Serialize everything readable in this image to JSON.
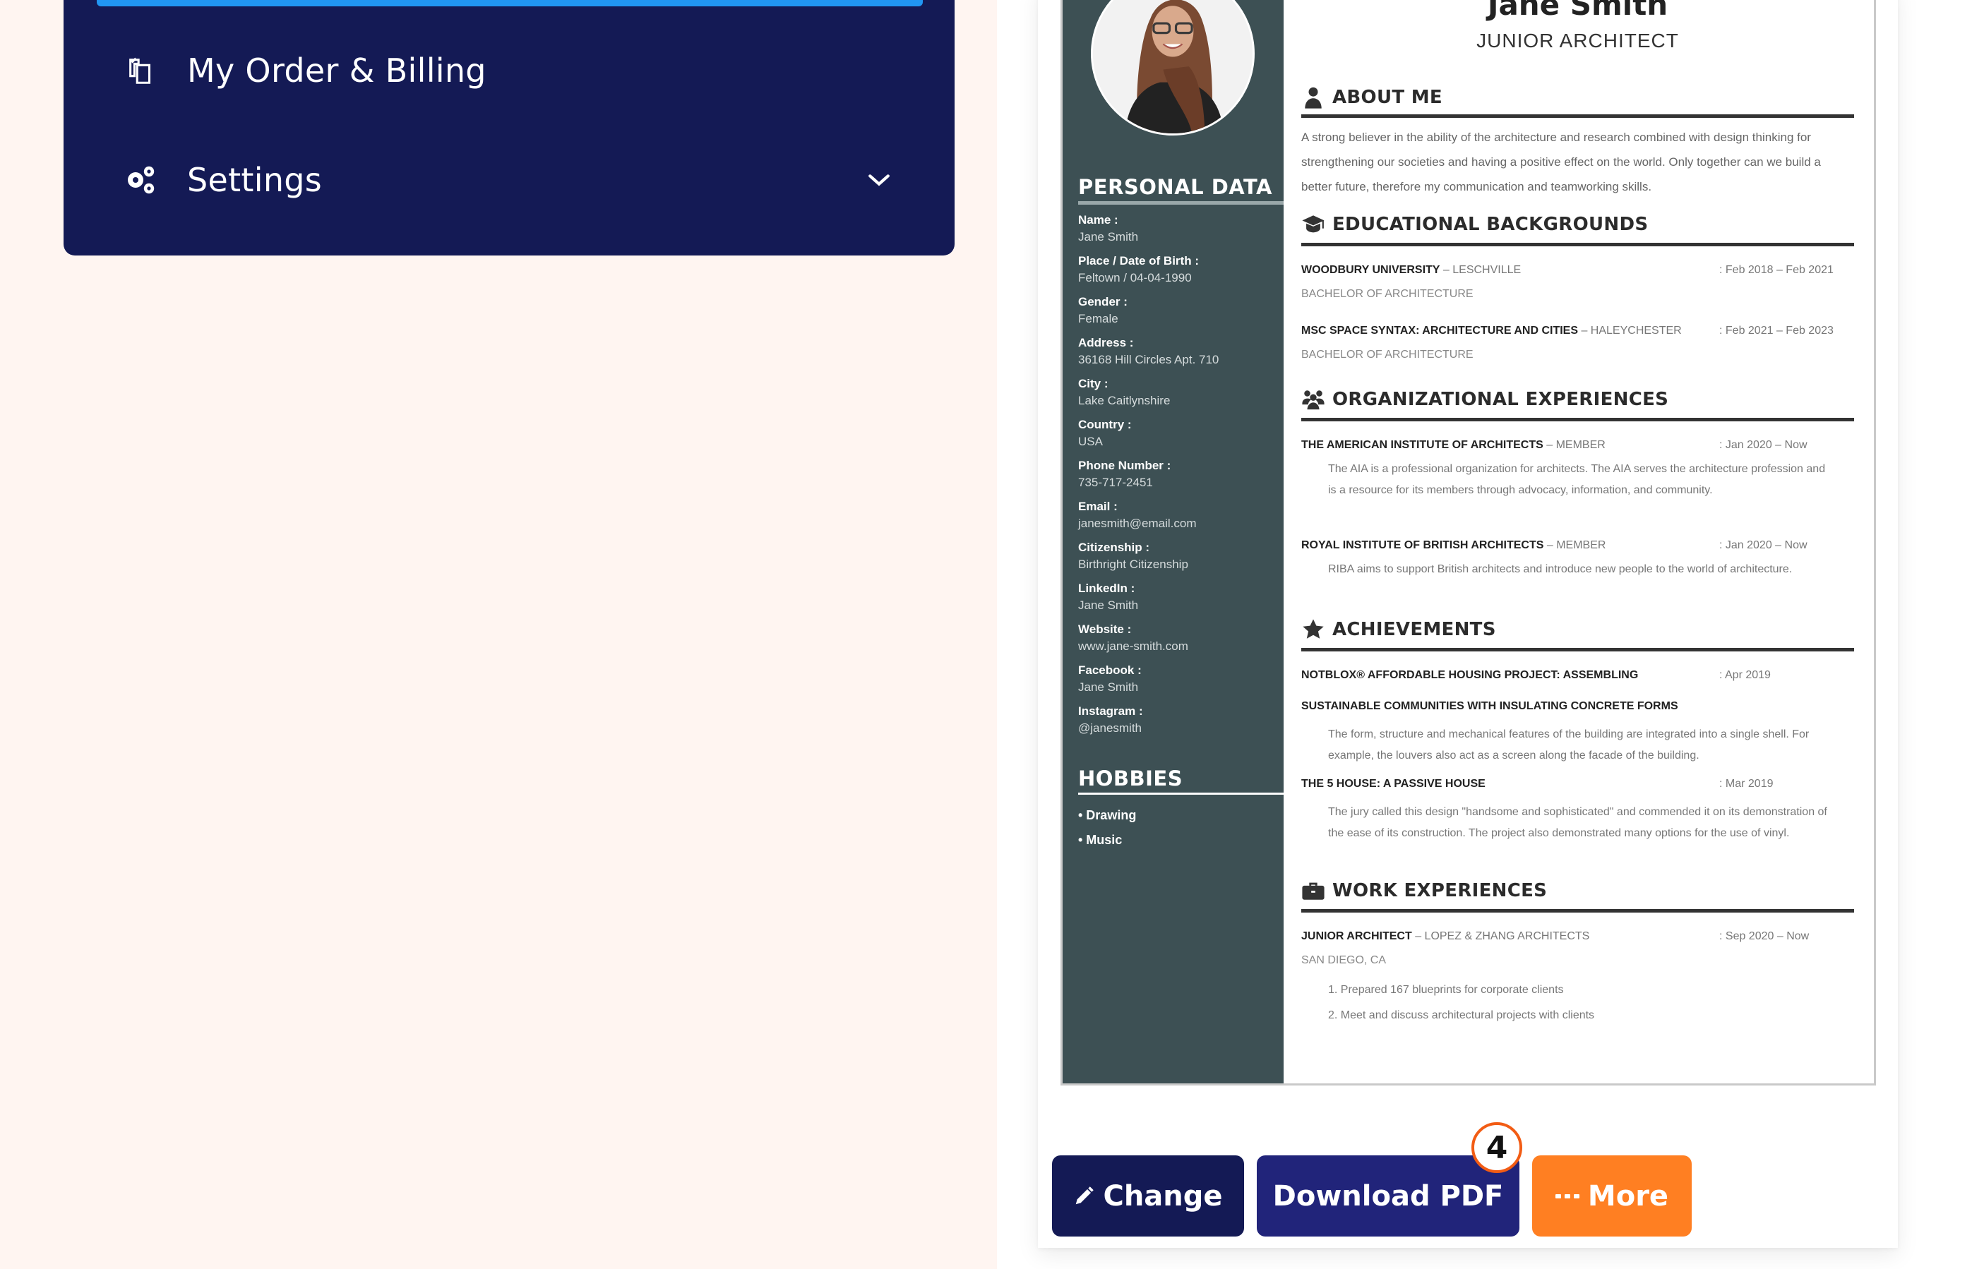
{
  "sidebar": {
    "items": [
      {
        "label": "My Order & Billing",
        "icon": "billing-icon"
      },
      {
        "label": "Settings",
        "icon": "gears-icon",
        "expandable": true
      }
    ]
  },
  "resume": {
    "name": "Jane Smith",
    "role": "JUNIOR ARCHITECT",
    "personal_data_title": "PERSONAL DATA",
    "personal_data": [
      {
        "key": "Name :",
        "value": "Jane Smith"
      },
      {
        "key": "Place / Date of Birth :",
        "value": "Feltown / 04-04-1990"
      },
      {
        "key": "Gender :",
        "value": "Female"
      },
      {
        "key": "Address :",
        "value": "36168 Hill Circles Apt. 710"
      },
      {
        "key": "City :",
        "value": "Lake Caitlynshire"
      },
      {
        "key": "Country :",
        "value": "USA"
      },
      {
        "key": "Phone Number :",
        "value": "735-717-2451"
      },
      {
        "key": "Email :",
        "value": "janesmith@email.com"
      },
      {
        "key": "Citizenship :",
        "value": "Birthright Citizenship"
      },
      {
        "key": "LinkedIn :",
        "value": "Jane Smith"
      },
      {
        "key": "Website :",
        "value": "www.jane-smith.com"
      },
      {
        "key": "Facebook :",
        "value": "Jane Smith"
      },
      {
        "key": "Instagram :",
        "value": "@janesmith"
      }
    ],
    "hobbies_title": "HOBBIES",
    "hobbies": [
      "• Drawing",
      "• Music"
    ],
    "about": {
      "title": "ABOUT ME",
      "text": "A strong believer in the ability of the architecture and research combined with design thinking for strengthening our societies and having a positive effect on the world. Only together can we build a better future, therefore my communication and teamworking skills."
    },
    "education": {
      "title": "EDUCATIONAL BACKGROUNDS",
      "entries": [
        {
          "title": "WOODBURY UNIVERSITY",
          "sub": " – LESCHVILLE",
          "date": ":  Feb 2018 – Feb 2021",
          "degree": "BACHELOR OF ARCHITECTURE"
        },
        {
          "title": "MSC SPACE SYNTAX: ARCHITECTURE AND CITIES",
          "sub": " – HALEYCHESTER",
          "date": ":  Feb 2021 – Feb 2023",
          "degree": "BACHELOR OF ARCHITECTURE"
        }
      ]
    },
    "organizations": {
      "title": "ORGANIZATIONAL EXPERIENCES",
      "entries": [
        {
          "title": "THE AMERICAN INSTITUTE OF ARCHITECTS",
          "sub": " – MEMBER",
          "date": ":  Jan 2020 – Now",
          "desc": "The AIA is a professional organization for architects. The AIA serves the architecture profession and is a resource for its members through advocacy, information, and community."
        },
        {
          "title": "ROYAL INSTITUTE OF BRITISH ARCHITECTS",
          "sub": " – MEMBER",
          "date": ":  Jan 2020 – Now",
          "desc": "RIBA aims to support British architects and introduce new people to the world of architecture."
        }
      ]
    },
    "achievements": {
      "title": "ACHIEVEMENTS",
      "entries": [
        {
          "title": "NOTBLOX® AFFORDABLE HOUSING PROJECT: ASSEMBLING",
          "date": ":  Apr 2019"
        },
        {
          "title": "SUSTAINABLE COMMUNITIES WITH INSULATING CONCRETE FORMS",
          "date": "",
          "desc": "The form, structure and mechanical features of the building are integrated into a single shell. For example, the louvers also act as a screen along the facade of the building."
        },
        {
          "title": "THE 5 HOUSE: A PASSIVE HOUSE",
          "date": ":  Mar 2019",
          "desc": "The jury called this design \"handsome and sophisticated\" and commended it on its demonstration of the ease of its construction. The project also demonstrated many options for the use of vinyl."
        }
      ]
    },
    "work": {
      "title": "WORK EXPERIENCES",
      "entries": [
        {
          "title": "JUNIOR ARCHITECT",
          "sub": " – LOPEZ & ZHANG ARCHITECTS",
          "date": ":  Sep 2020 – Now",
          "location": "SAN DIEGO, CA",
          "points": [
            "1. Prepared 167 blueprints for corporate clients",
            "2. Meet and discuss architectural projects with clients"
          ]
        }
      ]
    }
  },
  "actions": {
    "change_label": "Change",
    "download_label": "Download PDF",
    "more_label": "More",
    "badge": "4"
  },
  "colors": {
    "sidebar_bg": "#141a55",
    "active_bar": "#2196f3",
    "resume_side": "#3d5054",
    "change_btn": "#141a55",
    "download_btn": "#21247a",
    "more_btn": "#ff7f22",
    "badge_ring": "#f25c14",
    "page_bg_left": "#fff5f1"
  }
}
